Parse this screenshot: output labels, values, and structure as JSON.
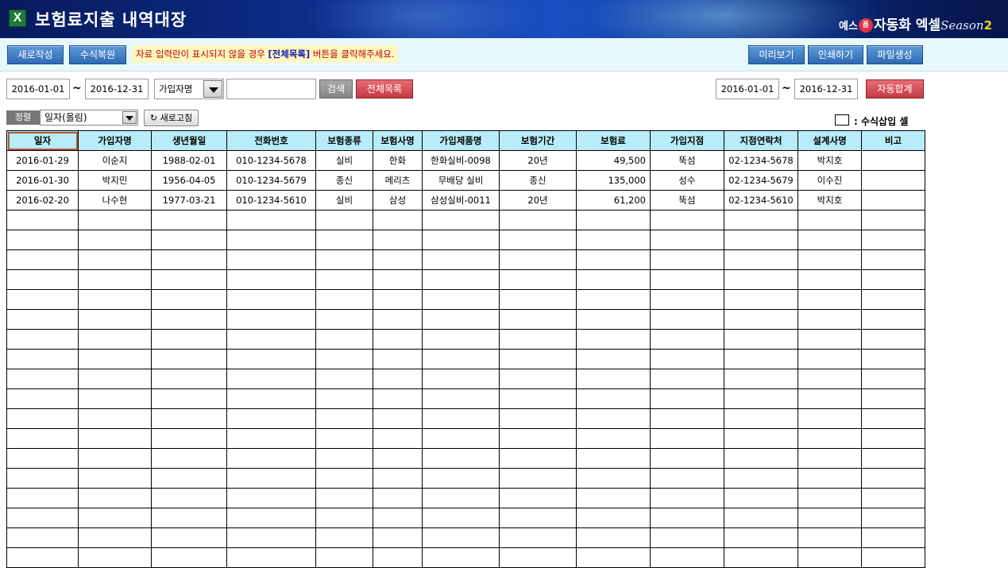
{
  "header": {
    "app_icon": "excel-icon",
    "title": "보험료지출 내역대장",
    "brand": {
      "prefix": "예스",
      "circle": "폼",
      "name": "자동화 엑셀",
      "season_text": "Season",
      "season_num": "2"
    }
  },
  "toolbar": {
    "new_label": "새로작성",
    "restore_label": "수식복원",
    "notice_prefix": "자료 입력란이 표시되지  않을 경우 ",
    "notice_highlight": "[전체목록]",
    "notice_suffix": " 버튼을 클릭해주세요.",
    "preview_label": "미리보기",
    "print_label": "인쇄하기",
    "file_label": "파일생성"
  },
  "filter": {
    "start_date": "2016-01-01",
    "end_date": "2016-12-31",
    "tilde": "~",
    "field_select": "가입자명",
    "search_value": "",
    "search_label": "검색",
    "list_all_label": "전체목록",
    "sum_start_date": "2016-01-01",
    "sum_end_date": "2016-12-31",
    "auto_sum_label": "자동합계"
  },
  "sort": {
    "label": "정렬",
    "value": "일자(올림)",
    "refresh_label": "새로고침"
  },
  "legend": {
    "text": ": 수식삽입 셀"
  },
  "table": {
    "columns": [
      "일자",
      "가입자명",
      "생년월일",
      "전화번호",
      "보험종류",
      "보험사명",
      "가입제품명",
      "보험기간",
      "보험료",
      "가입지점",
      "지점연락처",
      "설계사명",
      "비고"
    ],
    "rows": [
      [
        "2016-01-29",
        "이순지",
        "1988-02-01",
        "010-1234-5678",
        "실비",
        "한화",
        "한화실비-0098",
        "20년",
        "49,500",
        "뚝섬",
        "02-1234-5678",
        "박지호",
        ""
      ],
      [
        "2016-01-30",
        "박지민",
        "1956-04-05",
        "010-1234-5679",
        "종신",
        "메리츠",
        "무배당 실비",
        "종신",
        "135,000",
        "성수",
        "02-1234-5679",
        "이수진",
        ""
      ],
      [
        "2016-02-20",
        "나수현",
        "1977-03-21",
        "010-1234-5610",
        "실비",
        "삼성",
        "삼성실비-0011",
        "20년",
        "61,200",
        "뚝섬",
        "02-1234-5610",
        "박지호",
        ""
      ]
    ],
    "empty_rows": 18
  },
  "colors": {
    "header_bg": "#b7ecf8",
    "toolbar_bg": "#e6f8fc",
    "button_blue": "#3c78c0",
    "button_red": "#d04a54"
  }
}
